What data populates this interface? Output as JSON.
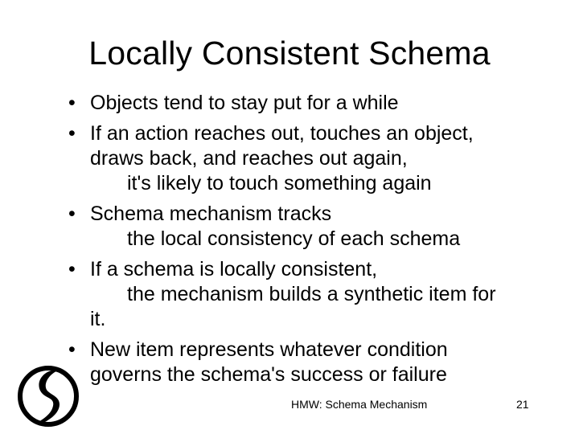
{
  "slide": {
    "title": "Locally Consistent Schema",
    "bullets": [
      {
        "mark": "•",
        "lines": [
          "Objects tend to stay put for a while"
        ]
      },
      {
        "mark": "•",
        "lines": [
          "If an action reaches out, touches an object,",
          "draws back, and reaches out again,",
          "it's likely to touch something again"
        ]
      },
      {
        "mark": "•",
        "lines": [
          "Schema mechanism tracks",
          "the local consistency of each schema"
        ]
      },
      {
        "mark": "•",
        "lines": [
          "If a schema is locally consistent,",
          "the mechanism builds a synthetic item for",
          "it."
        ]
      },
      {
        "mark": "•",
        "lines": [
          "New item represents whatever condition",
          "governs the schema's success or failure"
        ]
      }
    ],
    "footer": {
      "center_text": "HMW: Schema Mechanism",
      "page_number": "21"
    },
    "logo_icon": "stylized-swirl-logo-icon"
  }
}
